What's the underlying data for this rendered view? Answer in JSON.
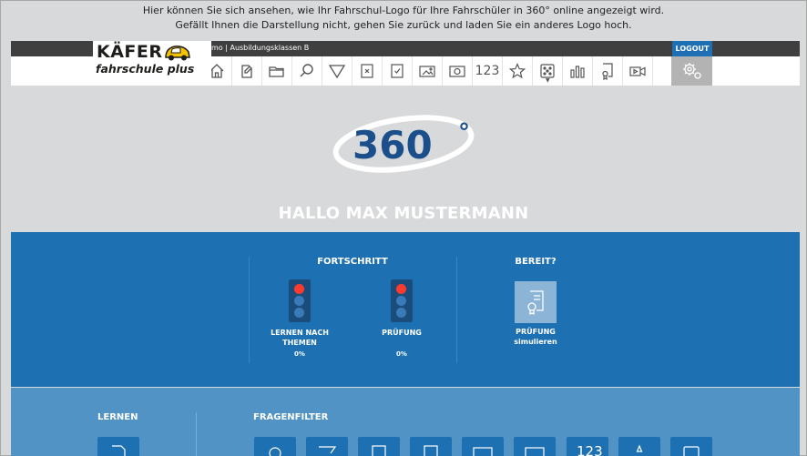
{
  "notice": {
    "line1": "Hier können Sie sich ansehen, wie Ihr Fahrschul-Logo für Ihre Fahrschüler in 360° online angezeigt wird.",
    "line2": "Gefällt Ihnen die Darstellung nicht, gehen Sie zurück und laden Sie ein anderes Logo hoch."
  },
  "header": {
    "breadcrumb": "demo | Ausbildungsklassen B",
    "logout_label": "LOGOUT",
    "logo": {
      "line1": "KÄFER",
      "line2": "fahrschule plus"
    }
  },
  "toolbar": {
    "icons": [
      "home-icon",
      "pen-note-icon",
      "folder-icon",
      "search-icon",
      "filter-icon",
      "cross-box-icon",
      "check-box-icon",
      "image-icon",
      "video-camera-icon",
      "counter-icon",
      "star-icon",
      "dice-icon",
      "chart-icon",
      "certificate-icon",
      "video-icon"
    ],
    "counter_label": "123"
  },
  "emblem": {
    "label": "360",
    "degree": "°"
  },
  "greeting": "HALLO MAX MUSTERMANN",
  "progress": {
    "title": "FORTSCHRITT",
    "items": [
      {
        "label_line1": "LERNEN NACH",
        "label_line2": "THEMEN",
        "percent": "0%"
      },
      {
        "label_line1": "PRÜFUNG",
        "label_line2": "",
        "percent": "0%"
      }
    ]
  },
  "ready": {
    "title": "BEREIT?",
    "label_line1": "PRÜFUNG",
    "label_line2": "simulieren"
  },
  "learn": {
    "title": "LERNEN",
    "filter_title": "FRAGENFILTER",
    "filter_counter_label": "123"
  },
  "colors": {
    "primary_blue": "#1d70b2",
    "light_blue": "#5293c6",
    "background": "#d8d9db",
    "light_red": "#ff3b30",
    "logo_yellow": "#f5c400"
  }
}
